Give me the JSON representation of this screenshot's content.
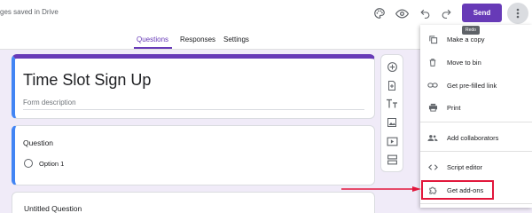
{
  "topbar": {
    "saved_text": "ges saved in Drive",
    "send_label": "Send",
    "tooltip": "Redo",
    "icons": [
      "palette-icon",
      "preview-eye-icon",
      "undo-icon",
      "redo-icon",
      "more-vert-icon"
    ]
  },
  "tabs": [
    {
      "label": "Questions",
      "active": true
    },
    {
      "label": "Responses",
      "active": false
    },
    {
      "label": "Settings",
      "active": false
    }
  ],
  "form": {
    "title": "Time Slot Sign Up",
    "description_placeholder": "Form description"
  },
  "question": {
    "title": "Question",
    "option": "Option 1"
  },
  "next_question": {
    "title": "Untitled Question"
  },
  "side_tools": [
    "add-question-icon",
    "import-questions-icon",
    "add-title-icon",
    "add-image-icon",
    "add-video-icon",
    "add-section-icon"
  ],
  "menu": {
    "items": [
      {
        "label": "Make a copy",
        "icon": "copy-icon"
      },
      {
        "label": "Move to bin",
        "icon": "trash-icon"
      },
      {
        "label": "Get pre-filled link",
        "icon": "link-icon"
      },
      {
        "label": "Print",
        "icon": "print-icon"
      },
      {
        "label": "Add collaborators",
        "icon": "collaborators-icon"
      },
      {
        "label": "Script editor",
        "icon": "code-icon"
      },
      {
        "label": "Get add-ons",
        "icon": "puzzle-icon",
        "highlighted": true
      }
    ]
  },
  "colors": {
    "accent": "#673ab7",
    "background": "#f0ebf8",
    "highlight": "#e2173c",
    "blue_edge": "#4285f4"
  }
}
